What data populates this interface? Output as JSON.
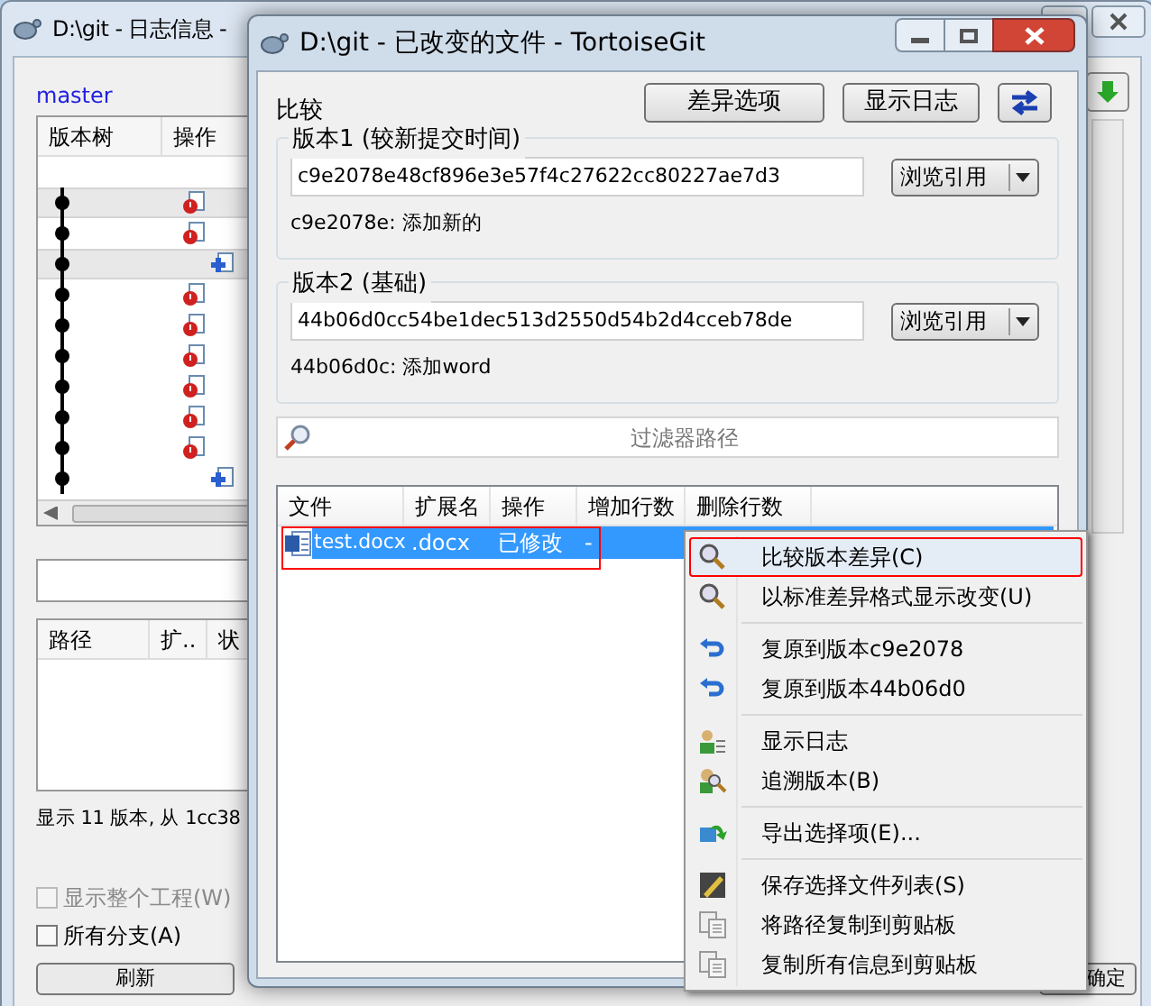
{
  "log_window": {
    "title": "D:\\git - 日志信息 -",
    "branch": "master",
    "log_columns": [
      "版本树",
      "操作"
    ],
    "log_rows": [
      {
        "kind": "working",
        "selected": false
      },
      {
        "kind": "modified",
        "selected": true
      },
      {
        "kind": "modified",
        "selected": false
      },
      {
        "kind": "added",
        "selected": true
      },
      {
        "kind": "modified",
        "selected": false
      },
      {
        "kind": "modified",
        "selected": false
      },
      {
        "kind": "modified",
        "selected": false
      },
      {
        "kind": "modified",
        "selected": false
      },
      {
        "kind": "modified",
        "selected": false
      },
      {
        "kind": "modified",
        "selected": false
      },
      {
        "kind": "added",
        "selected": false
      }
    ],
    "file_columns": [
      "路径",
      "扩..",
      "状"
    ],
    "status": "显示 11 版本, 从 1cc38",
    "checkboxes": [
      {
        "label": "显示整个工程(W)",
        "checked": false,
        "disabled": true
      },
      {
        "label": "所有分支(A)",
        "checked": false,
        "disabled": false
      }
    ],
    "refresh_button": "刷新",
    "ok_button": "确定"
  },
  "dialog": {
    "title": "D:\\git - 已改变的文件 - TortoiseGit",
    "compare_label": "比较",
    "buttons": [
      "差异选项",
      "显示日志"
    ],
    "revisions": [
      {
        "label": "版本1 (较新提交时间)",
        "hash": "c9e2078e48cf896e3e57f4c27622cc80227ae7d3",
        "browse": "浏览引用",
        "summary": "c9e2078e: 添加新的"
      },
      {
        "label": "版本2 (基础)",
        "hash": "44b06d0cc54be1dec513d2550d54b2d4cceb78de",
        "browse": "浏览引用",
        "summary": "44b06d0c: 添加word"
      }
    ],
    "filter": {
      "placeholder": "过滤器路径"
    },
    "columns": [
      "文件",
      "扩展名",
      "操作",
      "增加行数",
      "删除行数"
    ],
    "rows": [
      {
        "file": "test.docx",
        "ext": ".docx",
        "action": "已修改",
        "added": "-",
        "selected": true
      }
    ]
  },
  "context_menu": {
    "items": [
      {
        "label": "比较版本差异(C)",
        "kind": "diff",
        "selected": true
      },
      {
        "label": "以标准差异格式显示改变(U)",
        "kind": "diff",
        "selected": false
      },
      {
        "kind": "separator"
      },
      {
        "label": "复原到版本c9e2078",
        "kind": "revert",
        "selected": false
      },
      {
        "label": "复原到版本44b06d0",
        "kind": "revert",
        "selected": false
      },
      {
        "kind": "separator"
      },
      {
        "label": "显示日志",
        "kind": "log",
        "selected": false
      },
      {
        "label": "追溯版本(B)",
        "kind": "blame",
        "selected": false
      },
      {
        "kind": "separator"
      },
      {
        "label": "导出选择项(E)...",
        "kind": "export",
        "selected": false
      },
      {
        "kind": "separator"
      },
      {
        "label": "保存选择文件列表(S)",
        "kind": "save",
        "selected": false
      },
      {
        "label": "将路径复制到剪贴板",
        "kind": "copy",
        "selected": false
      },
      {
        "label": "复制所有信息到剪贴板",
        "kind": "copy",
        "selected": false
      }
    ]
  }
}
